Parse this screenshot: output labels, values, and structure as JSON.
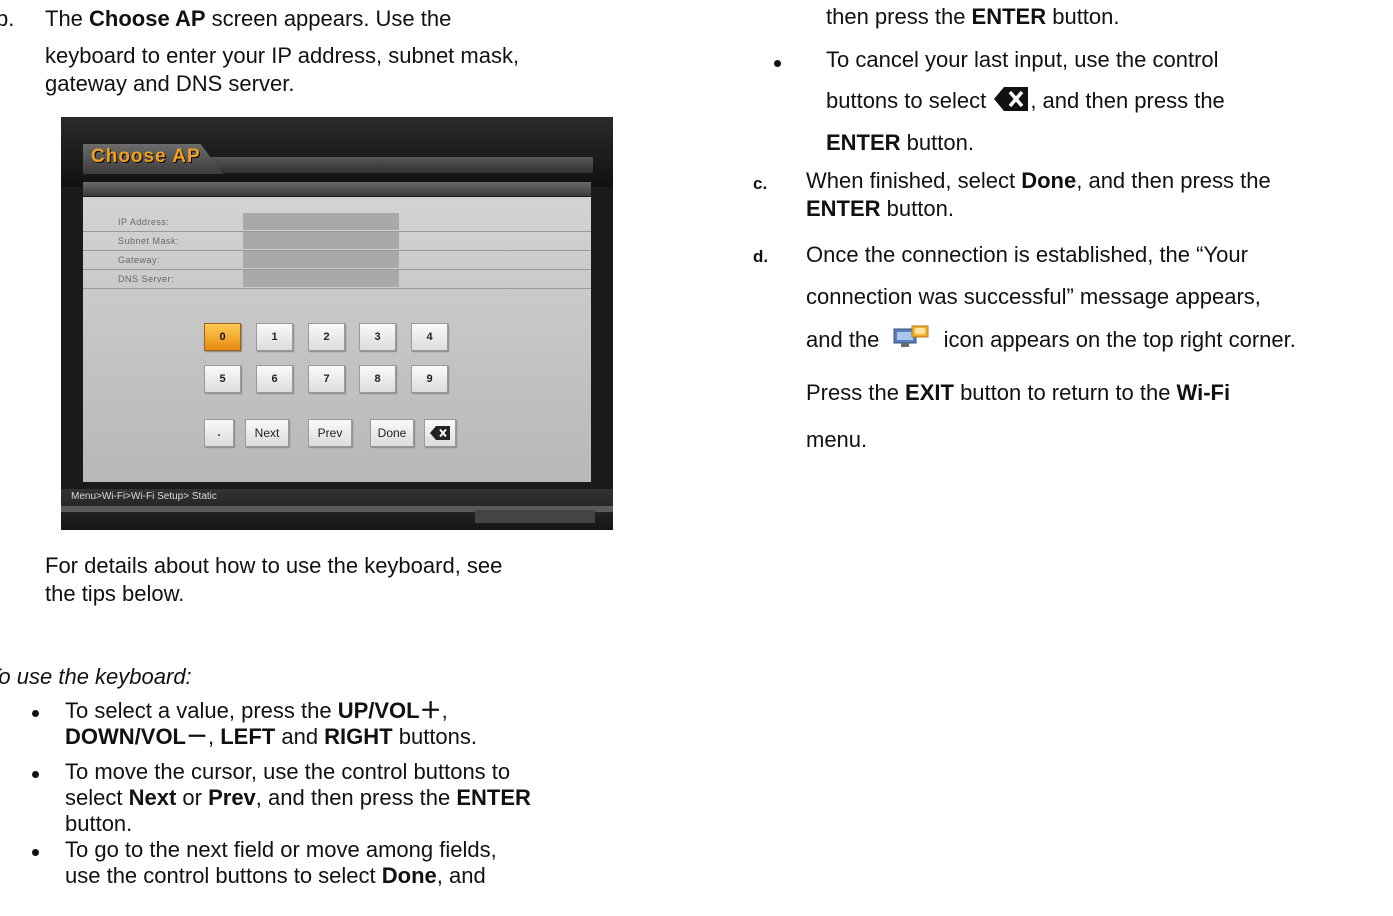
{
  "left": {
    "step_b": {
      "marker": "b.",
      "lines": [
        [
          "The ",
          "Choose AP",
          " screen appears. Use the"
        ],
        [
          "keyboard to enter your IP address, subnet mask,"
        ],
        [
          "gateway and DNS server."
        ]
      ]
    },
    "screen": {
      "title": "Choose AP",
      "fields": [
        "IP Address:",
        "Subnet Mask:",
        "Gateway:",
        "DNS Server:"
      ],
      "keys_row1": [
        "0",
        "1",
        "2",
        "3",
        "4"
      ],
      "keys_row2": [
        "5",
        "6",
        "7",
        "8",
        "9"
      ],
      "keys_row3": [
        ".",
        "Next",
        "Prev",
        "Done"
      ],
      "breadcrumb": "Menu>Wi-Fi>Wi-Fi Setup> Static"
    },
    "details": [
      "For details about how to use the keyboard, see",
      "the tips below."
    ],
    "tips_heading": "To use the keyboard:",
    "tips": [
      [
        [
          "To select a value, press the ",
          "UP/VOL＋",
          ","
        ],
        [
          "",
          "DOWN/VOL－",
          ", ",
          "LEFT",
          " and ",
          "RIGHT",
          " buttons."
        ]
      ],
      [
        [
          "To move the cursor, use the control buttons to"
        ],
        [
          "select ",
          "Next",
          " or ",
          "Prev",
          ", and then press the ",
          "ENTER"
        ],
        [
          "button."
        ]
      ],
      [
        [
          "To go to the next field or move among fields,"
        ],
        [
          "use the control buttons to select ",
          "Done",
          ", and"
        ]
      ]
    ]
  },
  "right": {
    "cont": [
      "then press the ",
      "ENTER",
      " button."
    ],
    "cancel": [
      [
        "To cancel your last input, use the control"
      ],
      [
        "buttons to select ",
        "",
        ", and then press the"
      ],
      [
        "",
        "ENTER",
        " button."
      ]
    ],
    "step_c": {
      "marker": "c.",
      "lines": [
        [
          "When finished, select ",
          "Done",
          ", and then press the"
        ],
        [
          "",
          "ENTER",
          " button."
        ]
      ]
    },
    "step_d": {
      "marker": "d.",
      "lines": [
        [
          "Once the connection is established, the “Your"
        ],
        [
          "connection was successful” message appears,"
        ],
        [
          "and the ",
          "",
          " icon appears on the top right corner."
        ],
        [
          "Press the ",
          "EXIT",
          " button to return to the ",
          "Wi-Fi"
        ],
        [
          "menu."
        ]
      ]
    }
  },
  "colors": {
    "screen_bg": "#1a1a1a",
    "title_orange": "#f2a020",
    "active_key": "#f0a020"
  }
}
